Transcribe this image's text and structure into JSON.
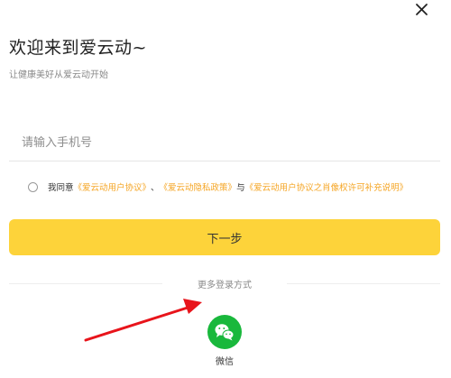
{
  "header": {
    "title": "欢迎来到爱云动~",
    "subtitle": "让健康美好从爱云动开始"
  },
  "phone_input": {
    "placeholder": "请输入手机号",
    "value": ""
  },
  "agreement": {
    "prefix": "我同意",
    "user_agreement": "《爱云动用户协议》",
    "separator": "、",
    "privacy_policy": "《爱云动隐私政策》",
    "conjunction": "与",
    "portrait_agreement": "《爱云动用户协议之肖像权许可补充说明》",
    "checked": false
  },
  "next_button": {
    "label": "下一步"
  },
  "more_login": {
    "label": "更多登录方式"
  },
  "wechat": {
    "label": "微信"
  },
  "colors": {
    "accent": "#fdd33a",
    "link": "#f5a524",
    "wechat_green": "#19b83c",
    "annotation_arrow": "#e8141b"
  },
  "icons": {
    "close": "close-icon",
    "wechat": "wechat-icon"
  }
}
